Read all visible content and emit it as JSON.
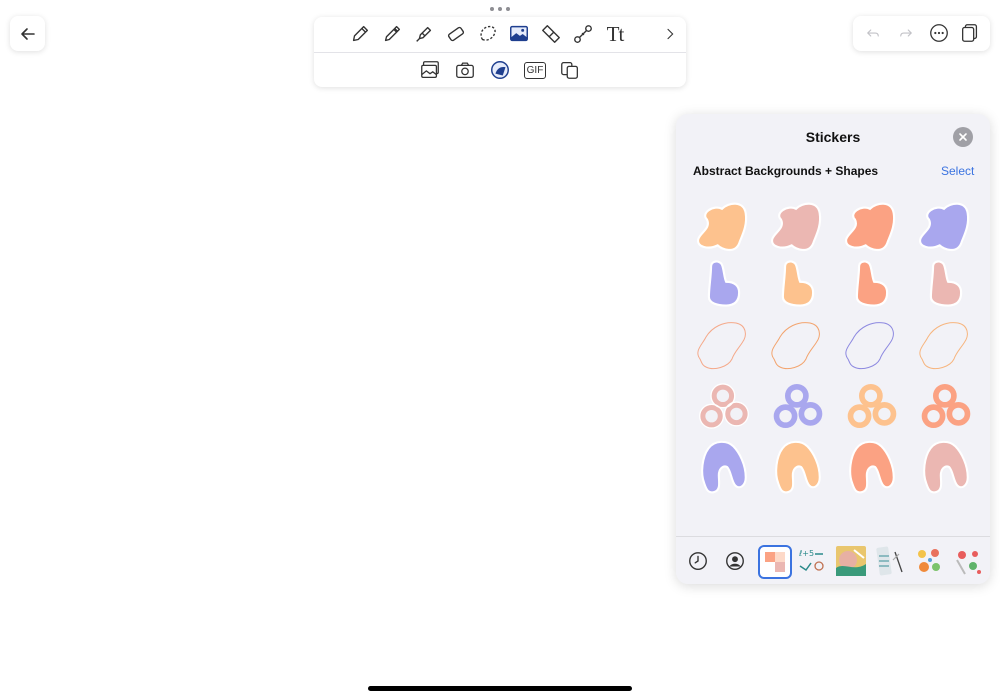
{
  "toolbar": {
    "row1_tools": [
      "pencil-icon",
      "marker-icon",
      "highlighter-icon",
      "eraser-icon",
      "lasso-icon",
      "image-icon",
      "shape-icon",
      "connector-icon",
      "text-icon",
      "chevron-right-icon"
    ],
    "text_tool_label": "Tt",
    "row2_tools": [
      "photo-library-icon",
      "camera-icon",
      "sticker-icon",
      "gif-icon",
      "copy-paste-icon"
    ],
    "gif_label": "GIF"
  },
  "right_controls": [
    "undo-icon",
    "redo-icon",
    "more-icon",
    "pages-icon"
  ],
  "stickers_panel": {
    "title": "Stickers",
    "section_title": "Abstract Backgrounds + Shapes",
    "select_label": "Select"
  },
  "colors": {
    "peach": "#fdc28e",
    "blush": "#ebb7b2",
    "coral": "#fba283",
    "lavender": "#a9a7ee",
    "accent_blue": "#3b73e0"
  },
  "tray": [
    "recent-icon",
    "profile-icon",
    "abstract-shapes-pack",
    "doodles-pack",
    "photo-pack",
    "stationery-pack",
    "food-pack",
    "fruit-pack"
  ]
}
